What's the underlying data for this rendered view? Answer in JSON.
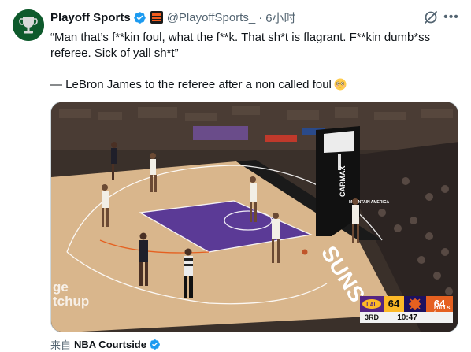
{
  "author": {
    "display_name": "Playoff Sports",
    "handle": "@PlayoffSports_",
    "separator": "·",
    "time": "6小时"
  },
  "tweet": {
    "line1": "“Man that’s f**kin foul, what the f**k. That sh*t is flagrant. F**kin dumb*ss referee. Sick of yall sh*t”",
    "line2": "— LeBron James to the referee after a non called foul",
    "emoji": "flushed-face"
  },
  "media": {
    "sideline_ad": "CARMAX",
    "ad_secondary": "MOUNTAIN AMERICA",
    "baseline_text": "SUNS",
    "board_text": "ge\ntchup",
    "scorebug": {
      "team1": "LAL",
      "team1_score": "64",
      "team2": "PHX",
      "team2_score": "64",
      "period": "3RD",
      "clock": "10:47",
      "fouls_label": "FOULS 2"
    }
  },
  "source": {
    "from_label": "来自",
    "name": "NBA Courtside"
  },
  "colors": {
    "verified_blue": "#1d9bf0",
    "avatar_green": "#0e5a2c",
    "lakers_purple": "#552583",
    "lakers_gold": "#fdb927",
    "suns_orange": "#e56020",
    "suns_purple": "#1d1160"
  }
}
